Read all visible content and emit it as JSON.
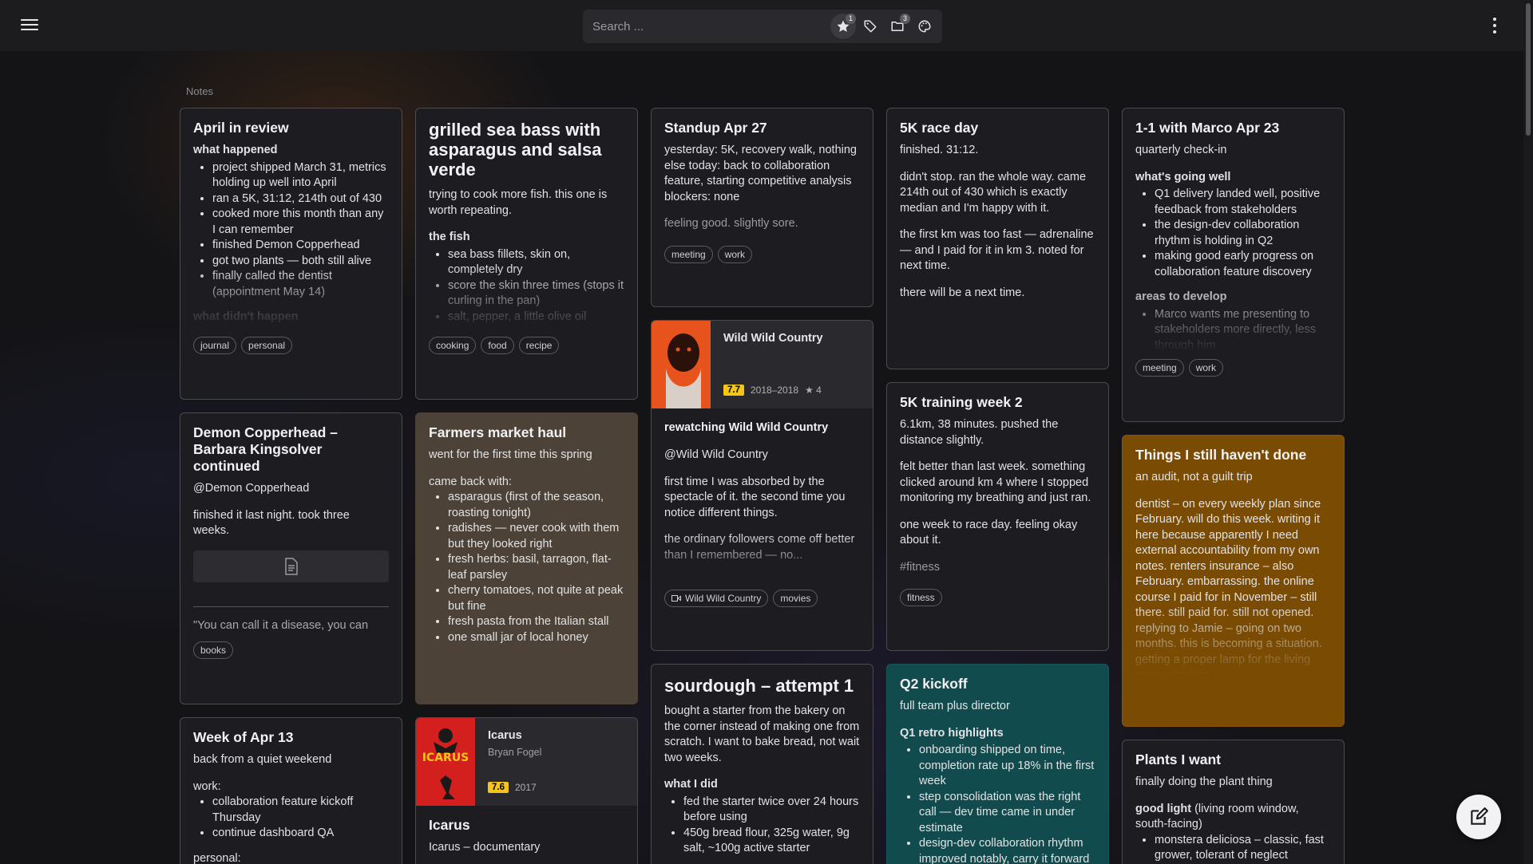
{
  "search": {
    "placeholder": "Search ..."
  },
  "toolbar": {
    "icons": [
      {
        "name": "star-icon",
        "badge": "1"
      },
      {
        "name": "tag-icon",
        "badge": ""
      },
      {
        "name": "folder-icon",
        "badge": "3"
      },
      {
        "name": "palette-icon",
        "badge": ""
      }
    ]
  },
  "section_label": "Notes",
  "cards": {
    "april": {
      "title": "April in review",
      "sub1": "what happened",
      "items": [
        "project shipped March 31, metrics holding up well into April",
        "ran a 5K, 31:12, 214th out of 430",
        "cooked more this month than any I can remember",
        "finished Demon Copperhead",
        "got two plants — both still alive",
        "finally called the dentist (appointment May 14)"
      ],
      "sub2": "what didn't happen",
      "tags": [
        "journal",
        "personal"
      ]
    },
    "seabass": {
      "title": "grilled sea bass with asparagus and salsa verde",
      "intro": "trying to cook more fish. this one is worth repeating.",
      "sub": "the fish",
      "items": [
        "sea bass fillets, skin on, completely dry",
        "score the skin three times (stops it curling in the pan)",
        "salt, pepper, a little olive oil"
      ],
      "tags": [
        "cooking",
        "food",
        "recipe"
      ]
    },
    "standup": {
      "title": "Standup Apr 27",
      "body": "yesterday: 5K, recovery walk, nothing else today: back to collaboration feature, starting competitive analysis blockers: none",
      "note": "feeling good. slightly sore.",
      "tags": [
        "meeting",
        "work"
      ]
    },
    "race": {
      "title": "5K race day",
      "p1": "finished. 31:12.",
      "p2": "didn't stop. ran the whole way. came 214th out of 430 which is exactly median and I'm happy with it.",
      "p3": "the first km was too fast — adrenaline — and I paid for it in km 3. noted for next time.",
      "p4": "there will be a next time."
    },
    "marco": {
      "title": "1-1 with Marco Apr 23",
      "intro": "quarterly check-in",
      "sub1": "what's going well",
      "items1": [
        "Q1 delivery landed well, positive feedback from stakeholders",
        "the design-dev collaboration rhythm is holding in Q2",
        "making good early progress on collaboration feature discovery"
      ],
      "sub2": "areas to develop",
      "items2": [
        "Marco wants me presenting to stakeholders more directly, less through him"
      ],
      "tags": [
        "meeting",
        "work"
      ]
    },
    "wwc": {
      "media_title": "Wild Wild Country",
      "rating": "7.7",
      "years": "2018–2018",
      "stars": "★ 4",
      "title": "rewatching Wild Wild Country",
      "mention": "@Wild Wild Country",
      "p1": "first time I was absorbed by the spectacle of it. the second time you notice different things.",
      "p2": "the ordinary followers come off better than I remembered — no...",
      "tags": [
        "Wild Wild Country",
        "movies"
      ]
    },
    "training": {
      "title": "5K training week 2",
      "p1": "6.1km, 38 minutes. pushed the distance slightly.",
      "p2": "felt better than last week. something clicked around km 4 where I stopped monitoring my breathing and just ran.",
      "p3": "one week to race day. feeling okay about it.",
      "hashtag": "#fitness",
      "tags": [
        "fitness"
      ]
    },
    "things": {
      "title": "Things I still haven't done",
      "intro": "an audit, not a guilt trip",
      "body": "dentist – on every weekly plan since February. will do this week. writing it here because apparently I need external accountability from my own notes. renters insurance – also February. embarrassing. the online course I paid for in November – still there. still paid for. still not opened. replying to Jamie – going on two months. this is becoming a situation. getting a proper lamp for the living room. ongoing."
    },
    "demon": {
      "title": "Demon Copperhead – Barbara Kingsolver continued",
      "mention": "@Demon Copperhead",
      "body": "finished it last night. took three weeks.",
      "quote": "\"You can call it a disease, you can",
      "tags": [
        "books"
      ]
    },
    "farmers": {
      "title": "Farmers market haul",
      "intro": "went for the first time this spring",
      "sub": "came back with:",
      "items": [
        "asparagus (first of the season, roasting tonight)",
        "radishes — never cook with them but they looked right",
        "fresh herbs: basil, tarragon, flat-leaf parsley",
        "cherry tomatoes, not quite at peak but fine",
        "fresh pasta from the Italian stall",
        "one small jar of local honey"
      ]
    },
    "sourdough": {
      "title": "sourdough – attempt 1",
      "intro": "bought a starter from the bakery on the corner instead of making one from scratch. I want to bake bread, not wait two weeks.",
      "sub": "what I did",
      "items": [
        "fed the starter twice over 24 hours before using",
        "450g bread flour, 325g water, 9g salt, ~100g active starter"
      ]
    },
    "q2": {
      "title": "Q2 kickoff",
      "intro": "full team plus director",
      "sub": "Q1 retro highlights",
      "items": [
        "onboarding shipped on time, completion rate up 18% in the first week",
        "step consolidation was the right call — dev time came in under estimate",
        "design-dev collaboration rhythm improved notably, carry it forward"
      ]
    },
    "week": {
      "title": "Week of Apr 13",
      "intro": "back from a quiet weekend",
      "sub": "work:",
      "items": [
        "collaboration feature kickoff Thursday",
        "continue dashboard QA"
      ],
      "sub2": "personal:"
    },
    "icarus": {
      "media_title": "Icarus",
      "director": "Bryan Fogel",
      "rating": "7.6",
      "year": "2017",
      "poster_text": "ICARUS",
      "title": "Icarus",
      "body": "Icarus – documentary"
    },
    "plants": {
      "title": "Plants I want",
      "intro": "finally doing the plant thing",
      "sub_bold": "good light",
      "sub_rest": " (living room window, south-facing)",
      "items": [
        "monstera deliciosa – classic, fast grower, tolerant of neglect"
      ]
    }
  }
}
